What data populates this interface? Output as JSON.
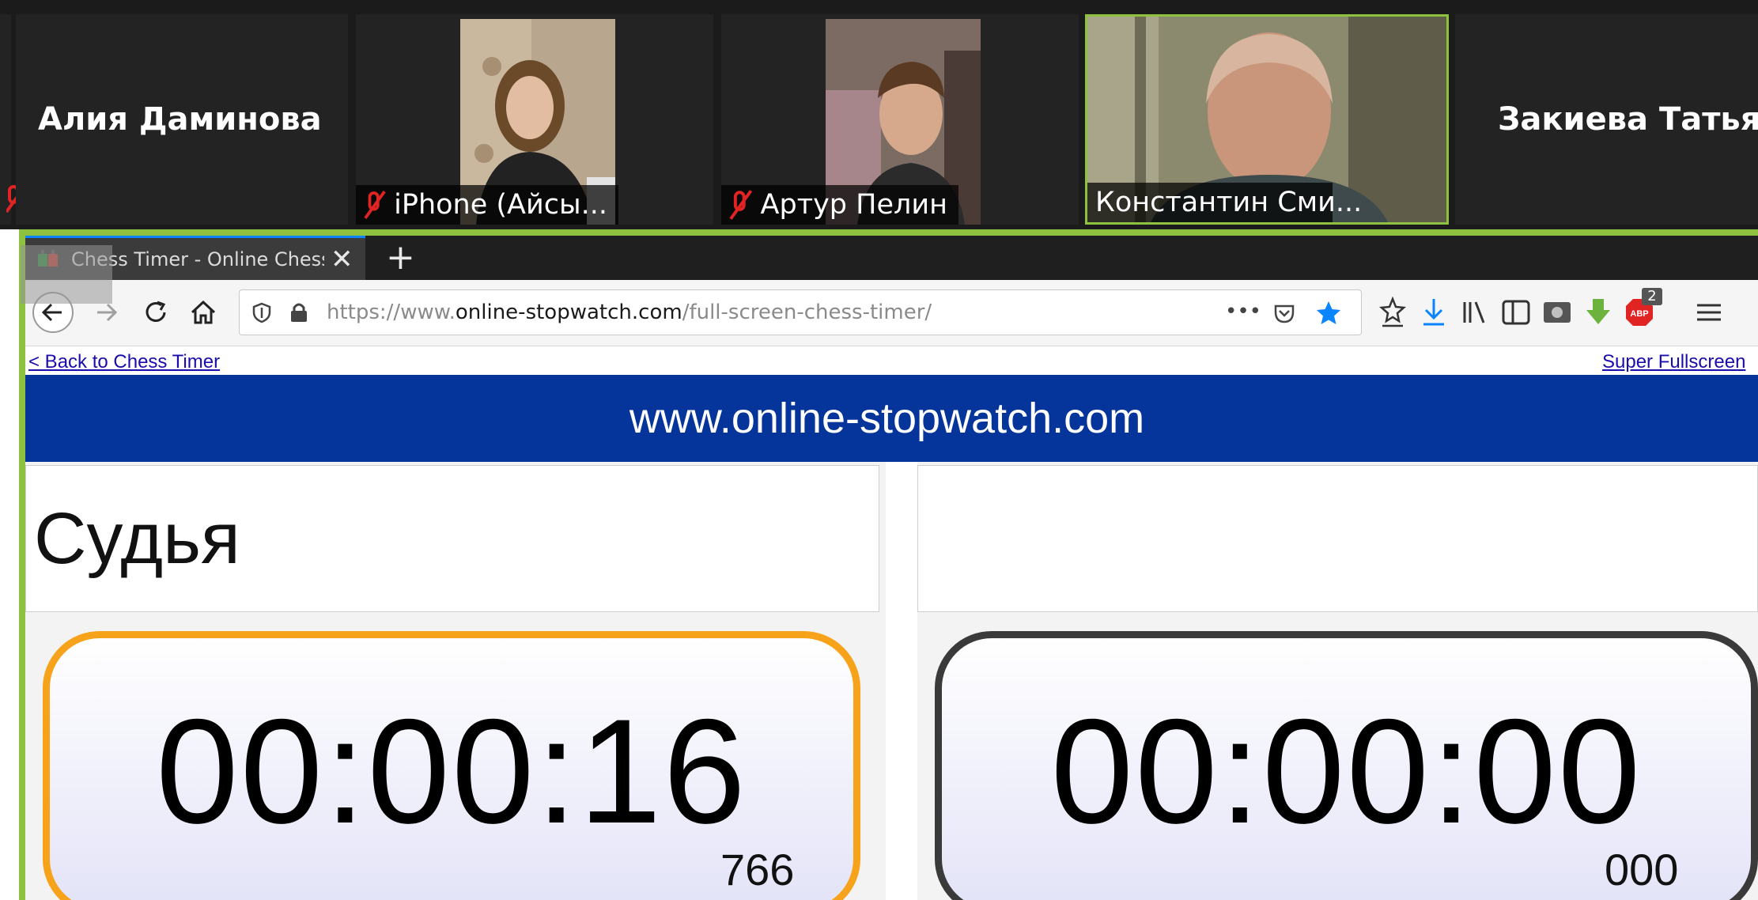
{
  "participants": [
    {
      "name": "Алия Даминова",
      "muted": true
    },
    {
      "name": "iPhone (Айсы...",
      "muted": true
    },
    {
      "name": "Артур Пелин",
      "muted": true
    },
    {
      "name": "Константин Сми...",
      "muted": false,
      "active_speaker": true
    },
    {
      "name": "Закиева Татьяна",
      "muted": false
    }
  ],
  "browser": {
    "tab_title": "Chess Timer - Online Chess",
    "tab_close": "✕",
    "new_tab": "+",
    "url_prefix": "https://www.",
    "url_domain": "online-stopwatch.com",
    "url_path": "/full-screen-chess-timer/",
    "url_dots": "•••",
    "adblock_badge": "2"
  },
  "page": {
    "back_link": "< Back to Chess Timer",
    "fullscreen_link": "Super Fullscreen",
    "banner": "www.online-stopwatch.com",
    "players": [
      {
        "name": "Судья",
        "time": "00:00:16",
        "ms": "766",
        "active": true
      },
      {
        "name": "",
        "time": "00:00:00",
        "ms": "000",
        "active": false
      }
    ]
  },
  "colors": {
    "active_clock_border": "#f7a21b",
    "idle_clock_border": "#3a3a3a",
    "banner": "#05349a",
    "speaker_highlight": "#8dc13f",
    "muted_icon": "#e02424",
    "bookmark_star": "#0a84ff"
  }
}
